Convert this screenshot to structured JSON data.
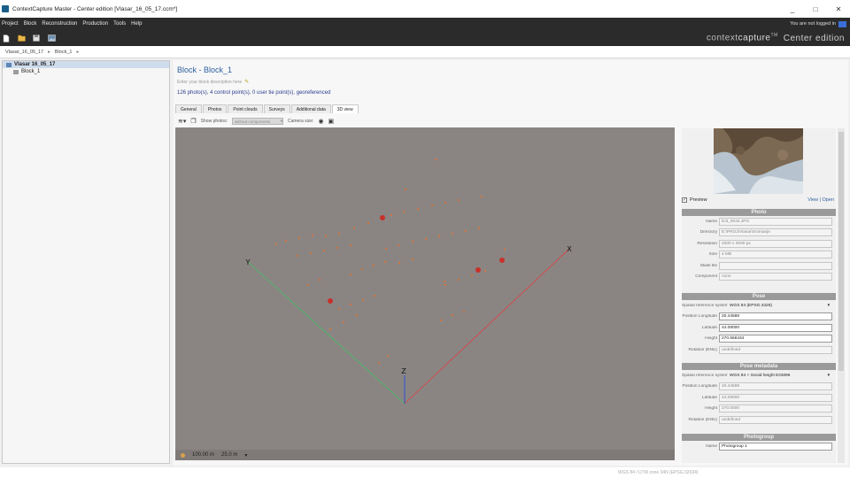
{
  "window": {
    "title": "ContextCapture Master - Center edition [Vlasar_16_05_17.ccm*]",
    "controls": [
      "_",
      "□",
      "✕"
    ]
  },
  "menu": {
    "items": [
      "Project",
      "Block",
      "Reconstruction",
      "Production",
      "Tools",
      "Help"
    ],
    "login_text": "You are not logged in"
  },
  "toolbar": {
    "buttons": [
      "new-file-icon",
      "open-folder-icon",
      "save-icon",
      "image-icon"
    ],
    "brand_context": "context",
    "brand_capture": "capture",
    "brand_tm": "TM",
    "brand_edition": "Center edition"
  },
  "breadcrumb": {
    "project": "Vlasar_16_05_17",
    "block": "Block_1"
  },
  "tree": {
    "project_label": "Vlasar 16_05_17",
    "block_label": "Block_1"
  },
  "block": {
    "title": "Block - Block_1",
    "description_placeholder": "Enter your block description here",
    "summary": "126 photo(s), 4 control point(s), 0 user tie point(s), georeferenced"
  },
  "tabs": [
    "General",
    "Photos",
    "Point clouds",
    "Surveys",
    "Additional data",
    "3D view"
  ],
  "active_tab": "3D view",
  "view3d": {
    "show_photos_label": "Show photos:",
    "show_photos_value": "without components",
    "camera_size_label": "Camera size:"
  },
  "footer": {
    "zoom": "100.00 m",
    "scale": "25.0 m"
  },
  "properties": {
    "preview_label": "Preview",
    "view_label": "View",
    "open_label": "Open",
    "photo_header": "Photo",
    "photo_rows": [
      {
        "label": "Name",
        "value": "DJI_0044.JPG"
      },
      {
        "label": "Directory",
        "value": "E:\\PROJ\\Vlasar\\Snimanje"
      },
      {
        "label": "Resolution",
        "value": "4000 x 3000 px"
      },
      {
        "label": "Size",
        "value": "4 MB"
      },
      {
        "label": "Mask file",
        "value": ""
      },
      {
        "label": "Component",
        "value": "none"
      }
    ],
    "pose_header": "Pose",
    "pose_srs_label": "Spatial reference system",
    "pose_srs_value": "WGS 84 (EPSG:4326)",
    "pose_rows": [
      {
        "label": "Position Longitude",
        "value": "20.44588",
        "editable": true
      },
      {
        "label": "Latitude",
        "value": "44.08000",
        "editable": true
      },
      {
        "label": "Height",
        "value": "270.558434",
        "editable": true
      },
      {
        "label": "Rotation (ENU)",
        "value": "undefined",
        "editable": false
      }
    ],
    "metadata_header": "Pose metadata",
    "meta_srs_label": "Spatial reference system",
    "meta_srs_value": "WGS 84 + Geoid height EGM96",
    "meta_rows": [
      {
        "label": "Position Longitude",
        "value": "20.44588"
      },
      {
        "label": "Latitude",
        "value": "44.08000"
      },
      {
        "label": "Height",
        "value": "270.0000"
      },
      {
        "label": "Rotation (ENU)",
        "value": "undefined"
      }
    ],
    "photogroup_header": "Photogroup",
    "photogroup_rows": [
      {
        "label": "Name",
        "value": "Photogroup 1"
      }
    ]
  },
  "status": {
    "text": "WGS 84 / UTM zone 34N (EPSG:32634)"
  },
  "colors": {
    "menubar": "#2b2b2b",
    "accent_blue": "#2e5f9e",
    "viewport": "#8a8583",
    "x_axis": "#e04040",
    "y_axis": "#40c060",
    "z_axis": "#3050d0",
    "camera_dots": "#d9763a",
    "control_points": "#c8302a"
  }
}
